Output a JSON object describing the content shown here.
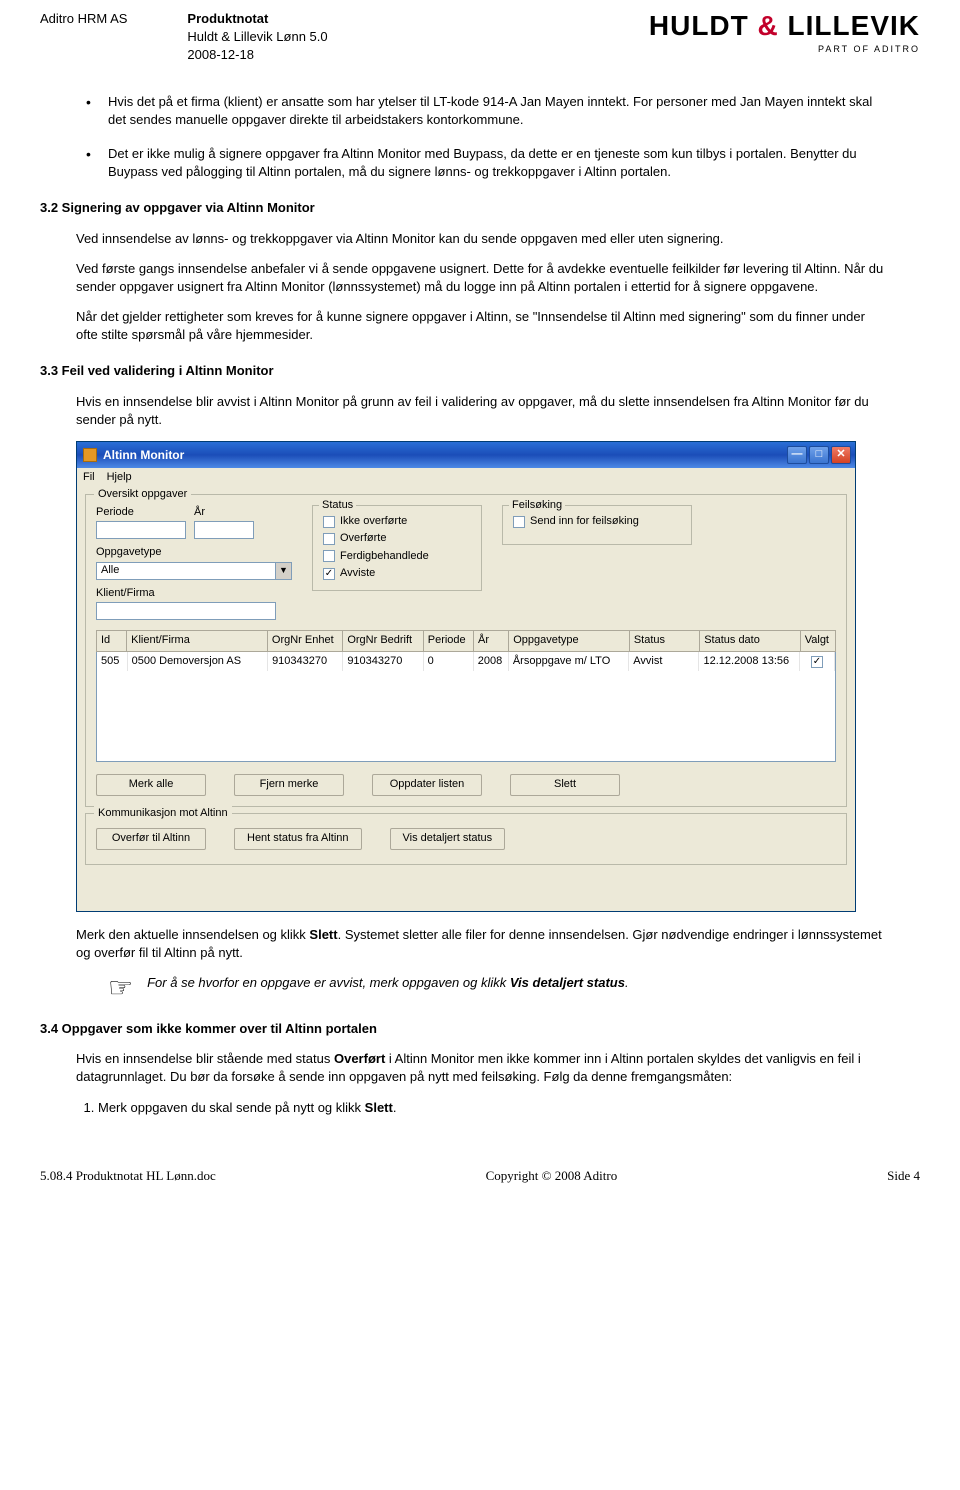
{
  "header": {
    "company": "Aditro HRM AS",
    "doc_title": "Produktnotat",
    "product": "Huldt & Lillevik Lønn 5.0",
    "date": "2008-12-18",
    "logo_text_left": "HULDT",
    "logo_text_right": "LILLEVIK",
    "logo_sub": "PART OF ADITRO"
  },
  "bullets": {
    "b1": "Hvis det på et firma (klient) er ansatte som har ytelser til LT-kode 914-A Jan Mayen inntekt. For personer med Jan Mayen inntekt skal det sendes manuelle oppgaver direkte til arbeidstakers kontorkommune.",
    "b2": "Det er ikke mulig å signere oppgaver fra Altinn Monitor med Buypass, da dette er en tjeneste som kun tilbys i portalen. Benytter du Buypass ved pålogging til Altinn portalen, må du signere lønns- og trekkoppgaver i Altinn portalen."
  },
  "s32": {
    "title": "3.2 Signering av oppgaver via Altinn Monitor",
    "p1": "Ved innsendelse av lønns- og trekkoppgaver via Altinn Monitor kan du sende oppgaven med eller uten signering.",
    "p2": "Ved første gangs innsendelse anbefaler vi å sende oppgavene usignert. Dette for å avdekke eventuelle feilkilder før levering til Altinn. Når du sender oppgaver usignert fra Altinn Monitor (lønnssystemet) må du logge inn på Altinn portalen i ettertid for å signere oppgavene.",
    "p3": "Når det gjelder rettigheter som kreves for å kunne signere oppgaver i Altinn, se \"Innsendelse til Altinn med signering\" som du finner under ofte stilte spørsmål på våre hjemmesider."
  },
  "s33": {
    "title": "3.3 Feil ved validering i Altinn Monitor",
    "p1": "Hvis en innsendelse blir avvist i Altinn Monitor på grunn av feil i validering av oppgaver, må du slette innsendelsen fra Altinn Monitor før du sender på nytt.",
    "p_after_a": "Merk den aktuelle innsendelsen og klikk ",
    "p_after_bold": "Slett",
    "p_after_b": ". Systemet sletter alle filer for denne innsendelsen. Gjør nødvendige endringer i lønnssystemet og overfør fil til Altinn på nytt.",
    "note_a": "For å se hvorfor en oppgave er avvist, merk oppgaven og klikk ",
    "note_bold": "Vis detaljert status",
    "note_b": "."
  },
  "s34": {
    "title": "3.4 Oppgaver som ikke kommer over til Altinn portalen",
    "p1_a": "Hvis en innsendelse blir stående med status ",
    "p1_bold": "Overført",
    "p1_b": " i Altinn Monitor men ikke kommer inn i Altinn portalen skyldes det vanligvis en feil i datagrunnlaget. Du bør da forsøke å sende inn oppgaven på nytt med feilsøking. Følg da denne fremgangsmåten:",
    "li1_a": "Merk oppgaven du skal sende på nytt og klikk ",
    "li1_bold": "Slett",
    "li1_b": "."
  },
  "altinn": {
    "title": "Altinn Monitor",
    "menu": {
      "file": "Fil",
      "help": "Hjelp"
    },
    "group_main": "Oversikt oppgaver",
    "labels": {
      "periode": "Periode",
      "aar": "År",
      "oppgavetype": "Oppgavetype",
      "klientfirma": "Klient/Firma"
    },
    "status_group": "Status",
    "status": {
      "ikke": "Ikke overførte",
      "over": "Overførte",
      "ferdig": "Ferdigbehandlede",
      "avv": "Avviste"
    },
    "feil_group": "Feilsøking",
    "feil_label": "Send inn for feilsøking",
    "oppgavetype_value": "Alle",
    "columns": {
      "id": "Id",
      "klientfirma": "Klient/Firma",
      "orgnrenhet": "OrgNr Enhet",
      "orgnrbedrift": "OrgNr Bedrift",
      "periode": "Periode",
      "aar": "År",
      "oppgavetype": "Oppgavetype",
      "status": "Status",
      "statusdato": "Status dato",
      "valgt": "Valgt"
    },
    "row": {
      "id": "505",
      "klientfirma": "0500 Demoversjon AS",
      "orgnrenhet": "910343270",
      "orgnrbedrift": "910343270",
      "periode": "0",
      "aar": "2008",
      "oppgavetype": "Årsoppgave m/ LTO",
      "status": "Avvist",
      "statusdato": "12.12.2008 13:56"
    },
    "buttons": {
      "merk_alle": "Merk alle",
      "fjern_merke": "Fjern merke",
      "oppdater": "Oppdater listen",
      "slett": "Slett"
    },
    "group_komm": "Kommunikasjon mot Altinn",
    "kbuttons": {
      "overfor": "Overfør til Altinn",
      "hent": "Hent status fra Altinn",
      "vis": "Vis detaljert status"
    }
  },
  "footer": {
    "left": "5.08.4 Produktnotat HL Lønn.doc",
    "center": "Copyright © 2008 Aditro",
    "right": "Side 4"
  }
}
